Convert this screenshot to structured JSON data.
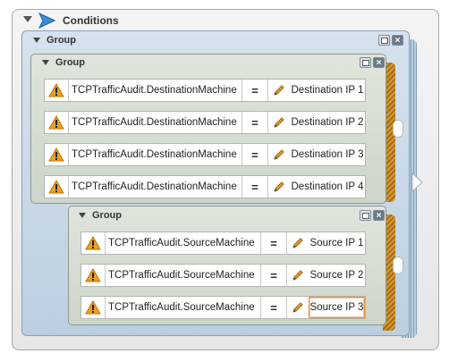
{
  "conditions": {
    "title": "Conditions"
  },
  "group_title": "Group",
  "operator": "=",
  "icons": {
    "warning": "warning-icon",
    "edit": "pencil-icon",
    "copy": "copy-icon",
    "close": "close-icon",
    "logo": "play-arrow-logo"
  },
  "groups": [
    {
      "rows": [
        {
          "field": "TCPTrafficAudit.DestinationMachine",
          "value": "Destination IP 1"
        },
        {
          "field": "TCPTrafficAudit.DestinationMachine",
          "value": "Destination IP 2"
        },
        {
          "field": "TCPTrafficAudit.DestinationMachine",
          "value": "Destination IP 3"
        },
        {
          "field": "TCPTrafficAudit.DestinationMachine",
          "value": "Destination IP 4"
        }
      ]
    },
    {
      "rows": [
        {
          "field": "TCPTrafficAudit.SourceMachine",
          "value": "Source IP 1"
        },
        {
          "field": "TCPTrafficAudit.SourceMachine",
          "value": "Source IP 2"
        },
        {
          "field": "TCPTrafficAudit.SourceMachine",
          "value": "Source IP 3",
          "editing": true
        }
      ]
    }
  ],
  "colors": {
    "warning": "#f0a020",
    "accent_edit": "#ea8f3b",
    "outer_group_bg": "#c9d8e6",
    "inner_group_bg": "#d4dcd0"
  }
}
